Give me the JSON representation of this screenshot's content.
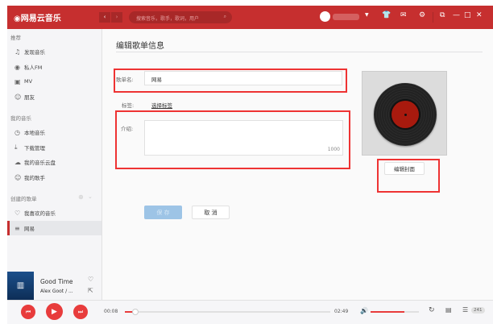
{
  "app": {
    "logo": "网易云音乐",
    "search_placeholder": "搜索音乐，歌手，歌词，用户"
  },
  "sidebar": {
    "sec_recommend": "推荐",
    "recommend": [
      {
        "icon": "music-note-icon",
        "label": "发现音乐"
      },
      {
        "icon": "radio-icon",
        "label": "私人FM"
      },
      {
        "icon": "video-icon",
        "label": "MV"
      },
      {
        "icon": "friends-icon",
        "label": "朋友"
      }
    ],
    "sec_mine": "我的音乐",
    "mine": [
      {
        "icon": "clock-icon",
        "label": "本地音乐"
      },
      {
        "icon": "download-icon",
        "label": "下载管理"
      },
      {
        "icon": "cloud-icon",
        "label": "我的音乐云盘"
      },
      {
        "icon": "singer-icon",
        "label": "我的歌手"
      }
    ],
    "sec_created": "创建的歌单",
    "created": [
      {
        "icon": "heart-icon",
        "label": "我喜欢的音乐"
      },
      {
        "icon": "playlist-icon",
        "label": "网易",
        "selected": true
      }
    ]
  },
  "now_playing": {
    "title": "Good Time",
    "artist": "Alex Goot / ..."
  },
  "edit": {
    "title": "编辑歌单信息",
    "name_label": "歌单名:",
    "name_value": "网易",
    "tag_label": "标签:",
    "tag_link": "选择标签",
    "intro_label": "介绍:",
    "intro_value": "",
    "intro_count": "1000",
    "edit_cover": "编辑封面",
    "save": "保 存",
    "cancel": "取 消"
  },
  "player": {
    "current": "00:08",
    "total": "02:49",
    "progress": 0.05,
    "volume": 0.7,
    "playlist_count": "241"
  },
  "colors": {
    "brand": "#c62f2f",
    "highlight": "#e33333",
    "save": "#9dc4e6"
  }
}
